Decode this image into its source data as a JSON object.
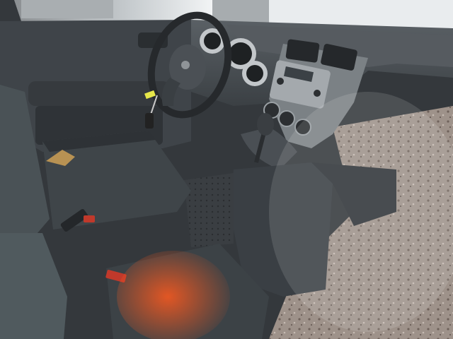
{
  "scene": {
    "subject": "car-interior-driver-side",
    "colors": {
      "interior_dark": "#2e3236",
      "interior_mid": "#4a5055",
      "dash_gray": "#5c6267",
      "console_gray": "#8d9296",
      "window_light": "#d9dde0",
      "orange_glare": "#e2642a",
      "key_tag": "#e6e64a",
      "gravel_ground": "#9d8f86"
    }
  }
}
